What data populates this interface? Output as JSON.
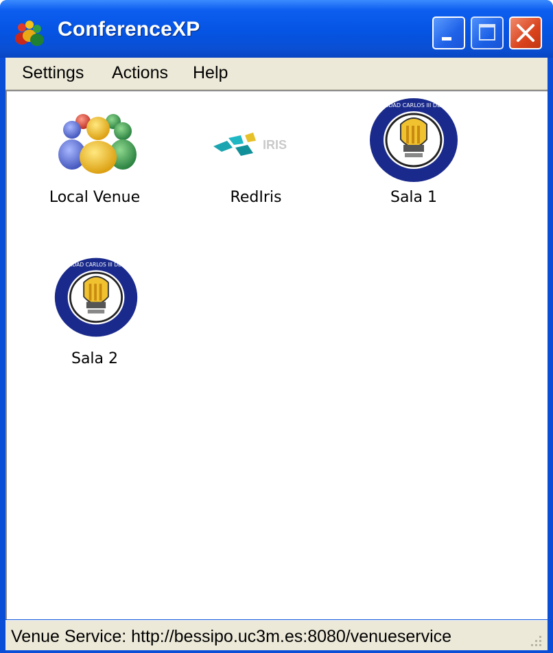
{
  "window": {
    "title": "ConferenceXP",
    "accent": "#0554e3",
    "buttons": [
      "minimize",
      "maximize",
      "close"
    ]
  },
  "menu": {
    "items": [
      {
        "label": "Settings"
      },
      {
        "label": "Actions"
      },
      {
        "label": "Help"
      }
    ]
  },
  "venues": [
    {
      "label": "Local Venue",
      "icon": "people-group-icon"
    },
    {
      "label": "RedIris",
      "icon": "rediris-logo-icon"
    },
    {
      "label": "Sala 1",
      "icon": "uc3m-seal-icon"
    },
    {
      "label": "Sala 2",
      "icon": "uc3m-seal-icon"
    }
  ],
  "seal_text": "UNIVERSIDAD CARLOS III DE MADRID",
  "rediris_logo_text": "IRIS",
  "status": {
    "text": "Venue Service: http://bessipo.uc3m.es:8080/venueservice"
  }
}
